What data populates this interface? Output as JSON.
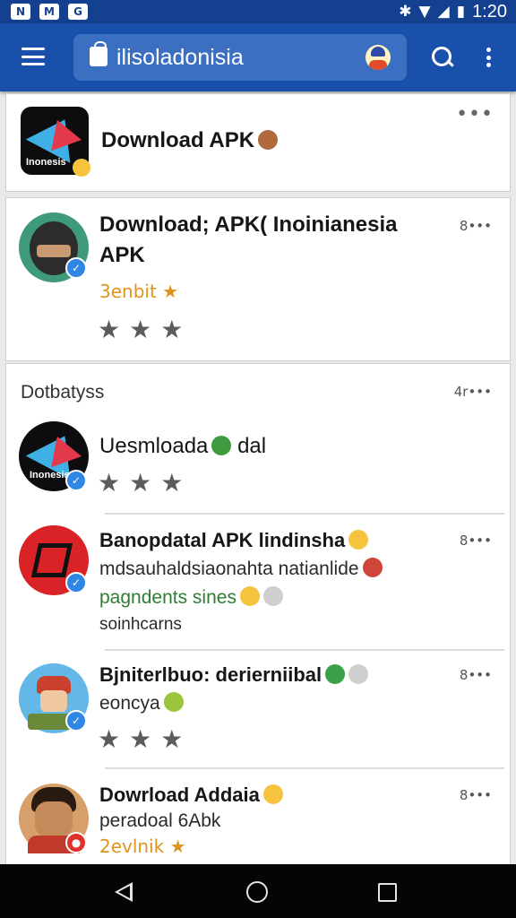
{
  "status_bar": {
    "time": "1:20",
    "left_icons": [
      "N",
      "M",
      "G"
    ]
  },
  "app_bar": {
    "search_text": "ilisoladonisia"
  },
  "featured": {
    "icon_caption": "Inonesis",
    "title": "Download APK"
  },
  "top_item": {
    "title_line1": "Download; APK( Inoinianesia",
    "title_line2": "APK",
    "rating_label": "3enbit",
    "count": "8"
  },
  "section": {
    "title": "Dotbatyss",
    "count": "4r"
  },
  "items": [
    {
      "icon_caption": "Inonesis",
      "title": "Uesmloada",
      "title_suffix": "dal",
      "count": ""
    },
    {
      "title": "Banopdatal APK lindinsha",
      "line2": "mdsauhaldsiaonahta natianlide",
      "line3": "pagndents sines",
      "line4": "soinhcarns",
      "count": "8"
    },
    {
      "title": "Bjniterlbuo: derierniibal",
      "line2": "eoncya",
      "count": "8"
    },
    {
      "title": "Dowrload Addaia",
      "line2": "peradoal 6Abk",
      "rating_label": "2evlnik",
      "count": "8"
    }
  ],
  "colors": {
    "status_bar": "#13408f",
    "app_bar": "#1850ac",
    "search_field": "#3a6fc2",
    "rating_orange": "#e0931c",
    "verified_blue": "#2f86e4"
  }
}
